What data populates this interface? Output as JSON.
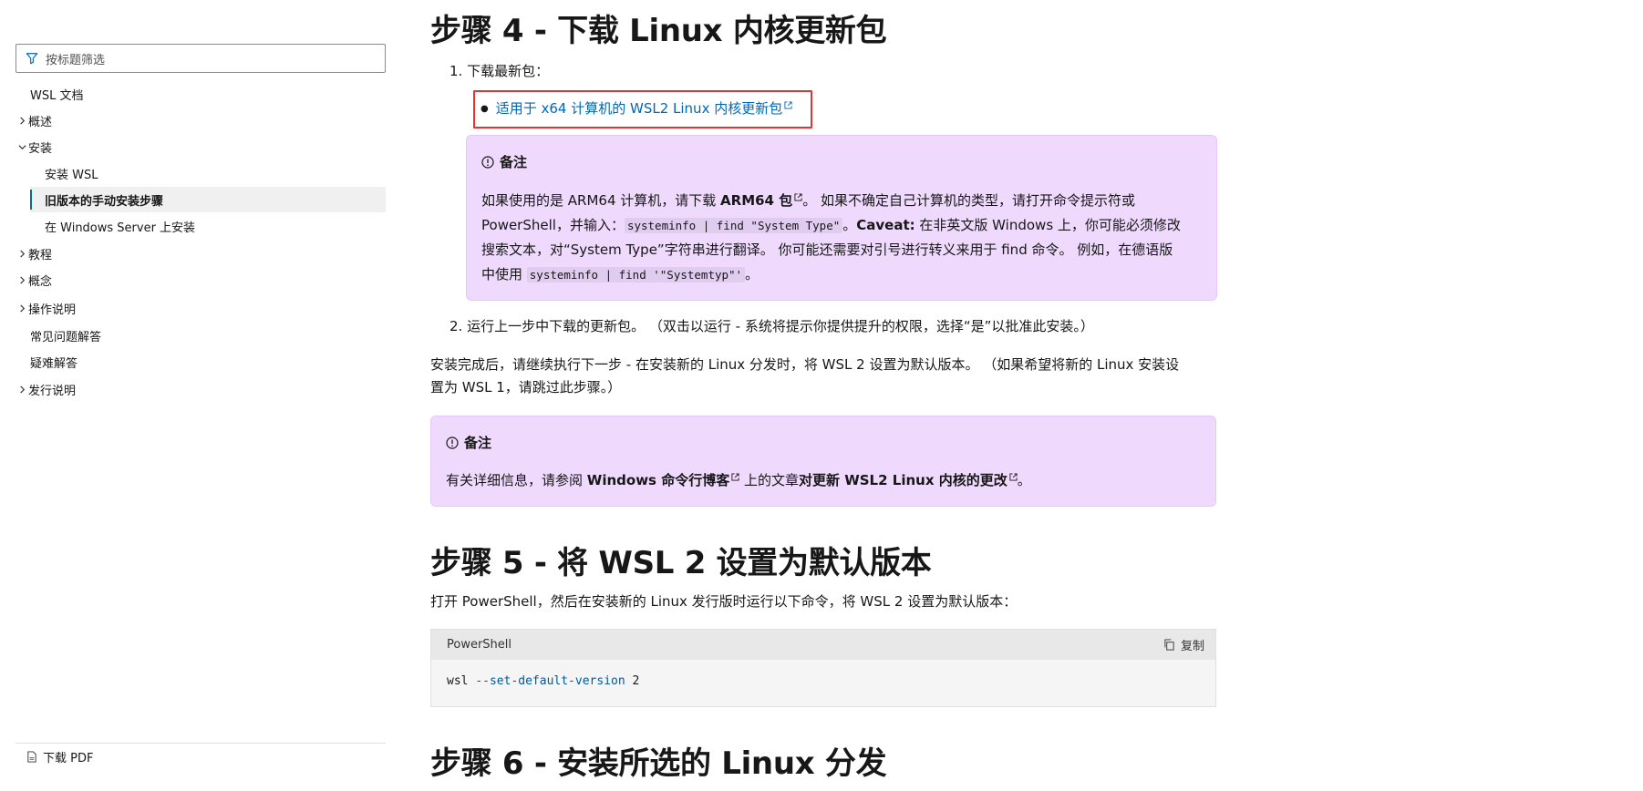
{
  "sidebar": {
    "filter_placeholder": "按标题筛选",
    "items": [
      {
        "label": "WSL 文档",
        "chevron": "none"
      },
      {
        "label": "概述",
        "chevron": "right"
      },
      {
        "label": "安装",
        "chevron": "down"
      },
      {
        "label": "安装 WSL",
        "chevron": "none"
      },
      {
        "label": "旧版本的手动安装步骤",
        "chevron": "none",
        "selected": true
      },
      {
        "label": "在 Windows Server 上安装",
        "chevron": "none"
      },
      {
        "label": "教程",
        "chevron": "right"
      },
      {
        "label": "概念",
        "chevron": "right"
      },
      {
        "label": "操作说明",
        "chevron": "right"
      },
      {
        "label": "常见问题解答",
        "chevron": "none"
      },
      {
        "label": "疑难解答",
        "chevron": "none"
      },
      {
        "label": "发行说明",
        "chevron": "right"
      }
    ],
    "download_pdf": "下载 PDF"
  },
  "main": {
    "step4": {
      "heading": "步骤 4 - 下载 Linux 内核更新包",
      "list1_num": "1.",
      "list1_text": "下载最新包：",
      "bullet_link": "适用于 x64 计算机的 WSL2 Linux 内核更新包",
      "note": {
        "title": "备注",
        "line1_a": "如果使用的是 ARM64 计算机，请下载 ",
        "line1_link": "ARM64 包",
        "line1_b": "。 如果不确定自己计算机的类型，请打开命令提示符或",
        "line2_a": "PowerShell，并输入：",
        "line2_code": "systeminfo | find \"System Type\"",
        "line2_b": "。",
        "line2_bold": "Caveat:",
        "line2_c": " 在非英文版 Windows 上，你可能必须修改",
        "line3": "搜索文本，对“System Type”字符串进行翻译。 你可能还需要对引号进行转义来用于 find 命令。 例如，在德语版",
        "line4_a": "中使用 ",
        "line4_code": "systeminfo | find '\"Systemtyp\"'",
        "line4_b": "。"
      },
      "list2_num": "2.",
      "list2_text": "运行上一步中下载的更新包。 （双击以运行 - 系统将提示你提供提升的权限，选择“是”以批准此安装。）",
      "after_line1": "安装完成后，请继续执行下一步 - 在安装新的 Linux 分发时，将 WSL 2 设置为默认版本。 （如果希望将新的 Linux 安装设",
      "after_line2": "置为 WSL 1，请跳过此步骤。）",
      "note2": {
        "title": "备注",
        "text_a": "有关详细信息，请参阅 ",
        "link1": "Windows 命令行博客",
        "text_b": " 上的文章",
        "link2": "对更新 WSL2 Linux 内核的更改",
        "text_c": "。"
      }
    },
    "step5": {
      "heading": "步骤 5 - 将 WSL 2 设置为默认版本",
      "text": "打开 PowerShell，然后在安装新的 Linux 发行版时运行以下命令，将 WSL 2 设置为默认版本：",
      "code_lang": "PowerShell",
      "copy_label": "复制",
      "code_cmd": "wsl",
      "code_param": "--set-default-version",
      "code_arg": "2"
    },
    "step6": {
      "heading": "步骤 6 - 安装所选的 Linux 分发"
    }
  },
  "colors": {
    "link": "#0067b8",
    "note_bg": "#efd9fd",
    "highlight": "#e63232"
  }
}
